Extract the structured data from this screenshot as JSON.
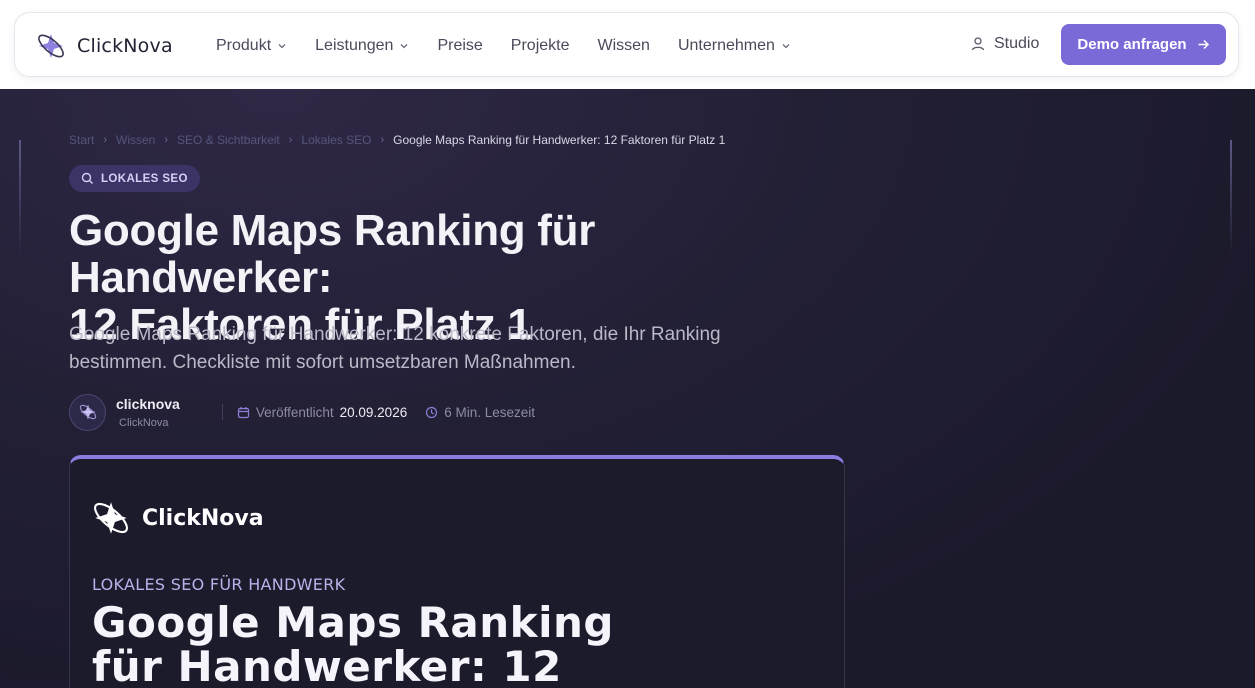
{
  "nav": {
    "brand": "ClickNova",
    "items": [
      {
        "label": "Produkt",
        "has_dropdown": true
      },
      {
        "label": "Leistungen",
        "has_dropdown": true
      },
      {
        "label": "Preise",
        "has_dropdown": false
      },
      {
        "label": "Projekte",
        "has_dropdown": false
      },
      {
        "label": "Wissen",
        "has_dropdown": false
      },
      {
        "label": "Unternehmen",
        "has_dropdown": true
      }
    ],
    "studio_label": "Studio",
    "cta_label": "Demo anfragen"
  },
  "breadcrumb": {
    "items": [
      "Start",
      "Wissen",
      "SEO & Sichtbarkeit",
      "Lokales SEO"
    ],
    "current": "Google Maps Ranking für Handwerker: 12 Faktoren für Platz 1"
  },
  "article": {
    "badge": "LOKALES SEO",
    "title_line1": "Google Maps Ranking für Handwerker:",
    "title_line2": "12 Faktoren für Platz 1",
    "subtitle_line1": "Google Maps Ranking für Handwerker: 12 konkrete Faktoren, die Ihr Ranking",
    "subtitle_line2": "bestimmen. Checkliste mit sofort umsetzbaren Maßnahmen.",
    "author_name": "clicknova",
    "author_org": "ClickNova",
    "published_label": "Veröffentlicht",
    "published_date": "20.09.2026",
    "read_time": "6 Min. Lesezeit"
  },
  "card": {
    "brand": "ClickNova",
    "kicker": "LOKALES SEO FÜR HANDWERK",
    "title_line1": "Google Maps Ranking",
    "title_line2": "für Handwerker: 12"
  },
  "colors": {
    "accent": "#7a6ad8",
    "hero_bg": "#1b1a2b",
    "badge_bg": "#3c3466"
  },
  "icons": [
    "clicknova-logo-icon",
    "chevron-down-icon",
    "user-icon",
    "arrow-right-icon",
    "search-icon",
    "calendar-icon",
    "clock-icon"
  ]
}
